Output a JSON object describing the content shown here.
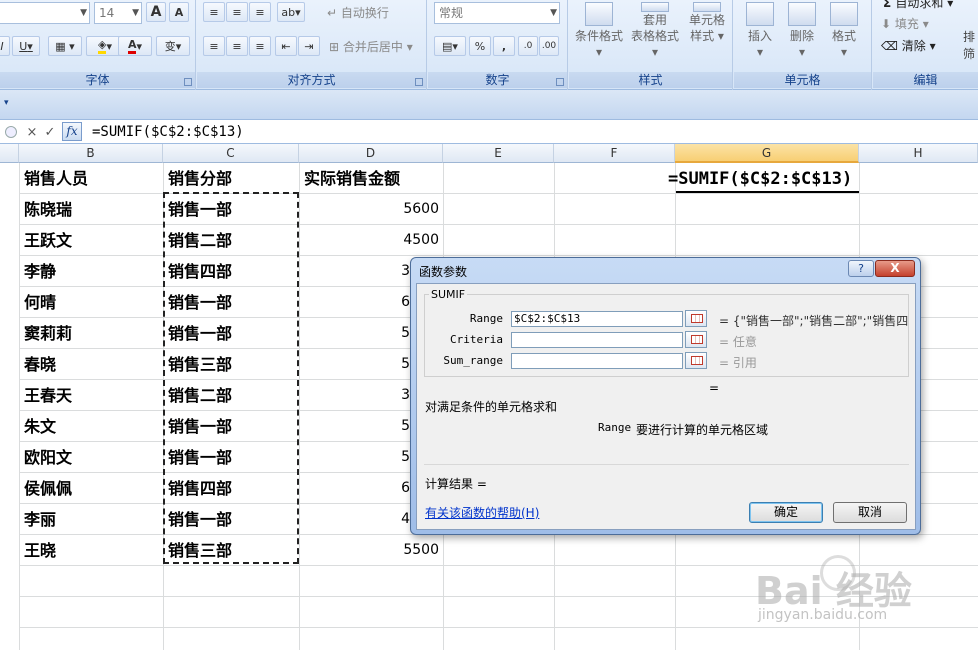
{
  "ribbon": {
    "font_size": "14",
    "bold_btn": "A",
    "shrink_btn": "A",
    "underline": "U",
    "wrap_text": "自动换行",
    "merge_center": "合并后居中",
    "number_format": "常规",
    "percent": "%",
    "comma": ",",
    "cond_format": "条件格式",
    "table_format_1": "套用",
    "table_format_2": "表格格式",
    "cell_style_1": "单元格",
    "cell_style_2": "样式",
    "insert": "插入",
    "delete": "删除",
    "format": "格式",
    "autosum": "自动求和",
    "fill": "填充",
    "clear": "清除",
    "sort": "排",
    "filter": "筛",
    "groups": {
      "font": "字体",
      "alignment": "对齐方式",
      "number": "数字",
      "styles": "样式",
      "cells": "单元格",
      "editing": "编辑"
    }
  },
  "formula_bar": {
    "cancel": "×",
    "enter": "✓",
    "fx": "fx",
    "formula": "=SUMIF($C$2:$C$13)"
  },
  "columns": [
    "B",
    "C",
    "D",
    "E",
    "F",
    "G",
    "H"
  ],
  "headers": {
    "b": "销售人员",
    "c": "销售分部",
    "d": "实际销售金额"
  },
  "rows": [
    {
      "name": "陈晓瑞",
      "dept": "销售一部",
      "amount": "5600"
    },
    {
      "name": "王跃文",
      "dept": "销售二部",
      "amount": "4500"
    },
    {
      "name": "李静",
      "dept": "销售四部",
      "amount": "3"
    },
    {
      "name": "何晴",
      "dept": "销售一部",
      "amount": "6"
    },
    {
      "name": "窦莉莉",
      "dept": "销售一部",
      "amount": "5"
    },
    {
      "name": "春晓",
      "dept": "销售三部",
      "amount": "5"
    },
    {
      "name": "王春天",
      "dept": "销售二部",
      "amount": "3"
    },
    {
      "name": "朱文",
      "dept": "销售一部",
      "amount": "5"
    },
    {
      "name": "欧阳文",
      "dept": "销售一部",
      "amount": "5"
    },
    {
      "name": "侯佩佩",
      "dept": "销售四部",
      "amount": "6"
    },
    {
      "name": "李丽",
      "dept": "销售一部",
      "amount": "4"
    },
    {
      "name": "王晓",
      "dept": "销售三部",
      "amount": "5500"
    }
  ],
  "g_cell": "=SUMIF($C$2:$C$13)",
  "dialog": {
    "title": "函数参数",
    "help_q": "?",
    "close": "X",
    "function_name": "SUMIF",
    "args": [
      {
        "label": "Range",
        "value": "$C$2:$C$13",
        "result": "= {\"销售一部\";\"销售二部\";\"销售四"
      },
      {
        "label": "Criteria",
        "value": "",
        "result": "= 任意"
      },
      {
        "label": "Sum_range",
        "value": "",
        "result": "= 引用"
      }
    ],
    "overall_eq": "=",
    "description": "对满足条件的单元格求和",
    "arg_help_name": "Range",
    "arg_help_text": "要进行计算的单元格区域",
    "result_label": "计算结果 =",
    "help_link": "有关该函数的帮助(H)",
    "ok": "确定",
    "cancel": "取消"
  },
  "watermark": {
    "brand": "Bai 经验",
    "url": "jingyan.baidu.com"
  }
}
